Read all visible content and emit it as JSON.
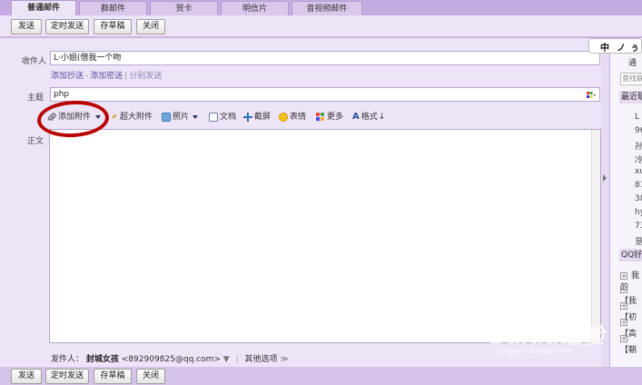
{
  "tabs": [
    {
      "label": "普通邮件",
      "active": true
    },
    {
      "label": "群邮件",
      "active": false
    },
    {
      "label": "贺卡",
      "active": false
    },
    {
      "label": "明信片",
      "active": false
    },
    {
      "label": "音视频邮件",
      "active": false
    }
  ],
  "toolbar": {
    "send": "发送",
    "timed_send": "定时发送",
    "save_draft": "存草稿",
    "close": "关闭"
  },
  "compose": {
    "recipient_label": "收件人",
    "recipient_value": "L·小姐(借我一个吻",
    "add_cc": "添加抄送",
    "add_bcc": "添加密送",
    "separate_send": "分别发送",
    "subject_label": "主题",
    "subject_value": "php",
    "body_label": "正文"
  },
  "editor_tools": {
    "attach": "添加附件",
    "super_attach": "超大附件",
    "photo": "照片",
    "document": "文档",
    "screenshot": "截屏",
    "emoticon": "表情",
    "more": "更多",
    "format": "格式"
  },
  "sender": {
    "label": "发件人：",
    "name": "封城女孩",
    "email": "<892909825@qq.com>",
    "other_options": "其他选项"
  },
  "ime": {
    "lang": "中",
    "mode1": "ノ",
    "mode2": "ぅ"
  },
  "sidebar": {
    "address_header": "通",
    "search_placeholder": "查找联",
    "recent_header": "最近联",
    "recent_contacts": [
      "L",
      "96",
      "孙",
      "冷",
      "xu",
      "81",
      "38",
      "hy",
      "73",
      "垦"
    ],
    "qq_header": "QQ好",
    "groups": [
      "我的",
      "【我",
      "【初",
      "【高",
      "【朝"
    ]
  },
  "watermark": {
    "logo": "Baidu经验",
    "url": "jingyan.baidu.com"
  },
  "colors": {
    "accent": "#c9b3df",
    "panel": "#eee4f7",
    "annotation": "#b80000"
  }
}
